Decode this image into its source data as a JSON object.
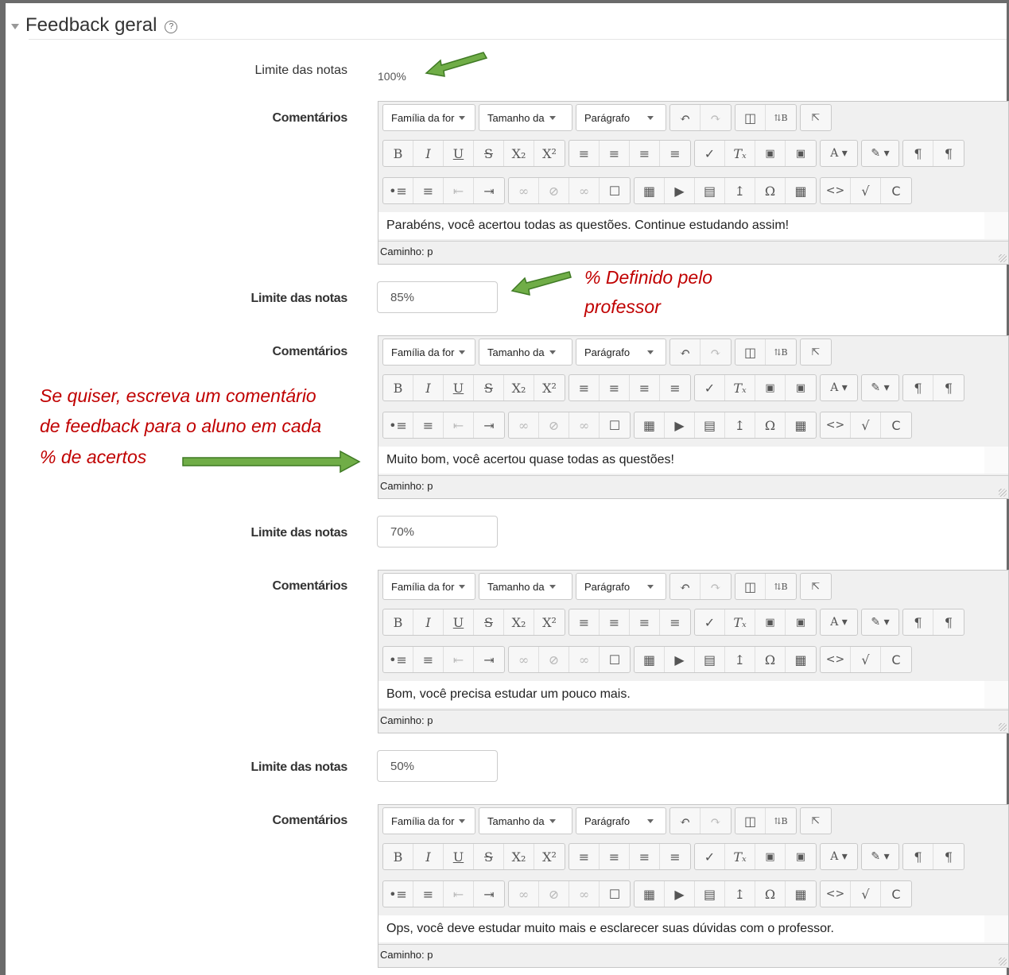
{
  "section": {
    "title": "Feedback geral",
    "help_icon": "question-circle-icon"
  },
  "labels": {
    "grade_limit": "Limite das notas",
    "comments": "Comentários"
  },
  "first_limit": "100%",
  "editor": {
    "font_family": "Família da for",
    "font_size": "Tamanho da",
    "block_format": "Parágrafo",
    "path": "Caminho: p"
  },
  "feedback": [
    {
      "limit": "100%",
      "comment": "Parabéns, você acertou todas as questões. Continue estudando assim!"
    },
    {
      "limit": "85%",
      "comment": "Muito bom, você acertou quase todas as questões!"
    },
    {
      "limit": "70%",
      "comment": "Bom, você precisa estudar um pouco mais."
    },
    {
      "limit": "50%",
      "comment": "Ops, você deve estudar muito mais e esclarecer suas dúvidas com o professor."
    }
  ],
  "annotations": {
    "teacher_note_1": "% Definido pelo",
    "teacher_note_2": "professor",
    "feedback_note_1": "Se quiser, escreva um comentário",
    "feedback_note_2": "de feedback para o aluno em cada",
    "feedback_note_3": "% de acertos",
    "arrow_color": "#70ad47",
    "text_color": "#c00000"
  }
}
